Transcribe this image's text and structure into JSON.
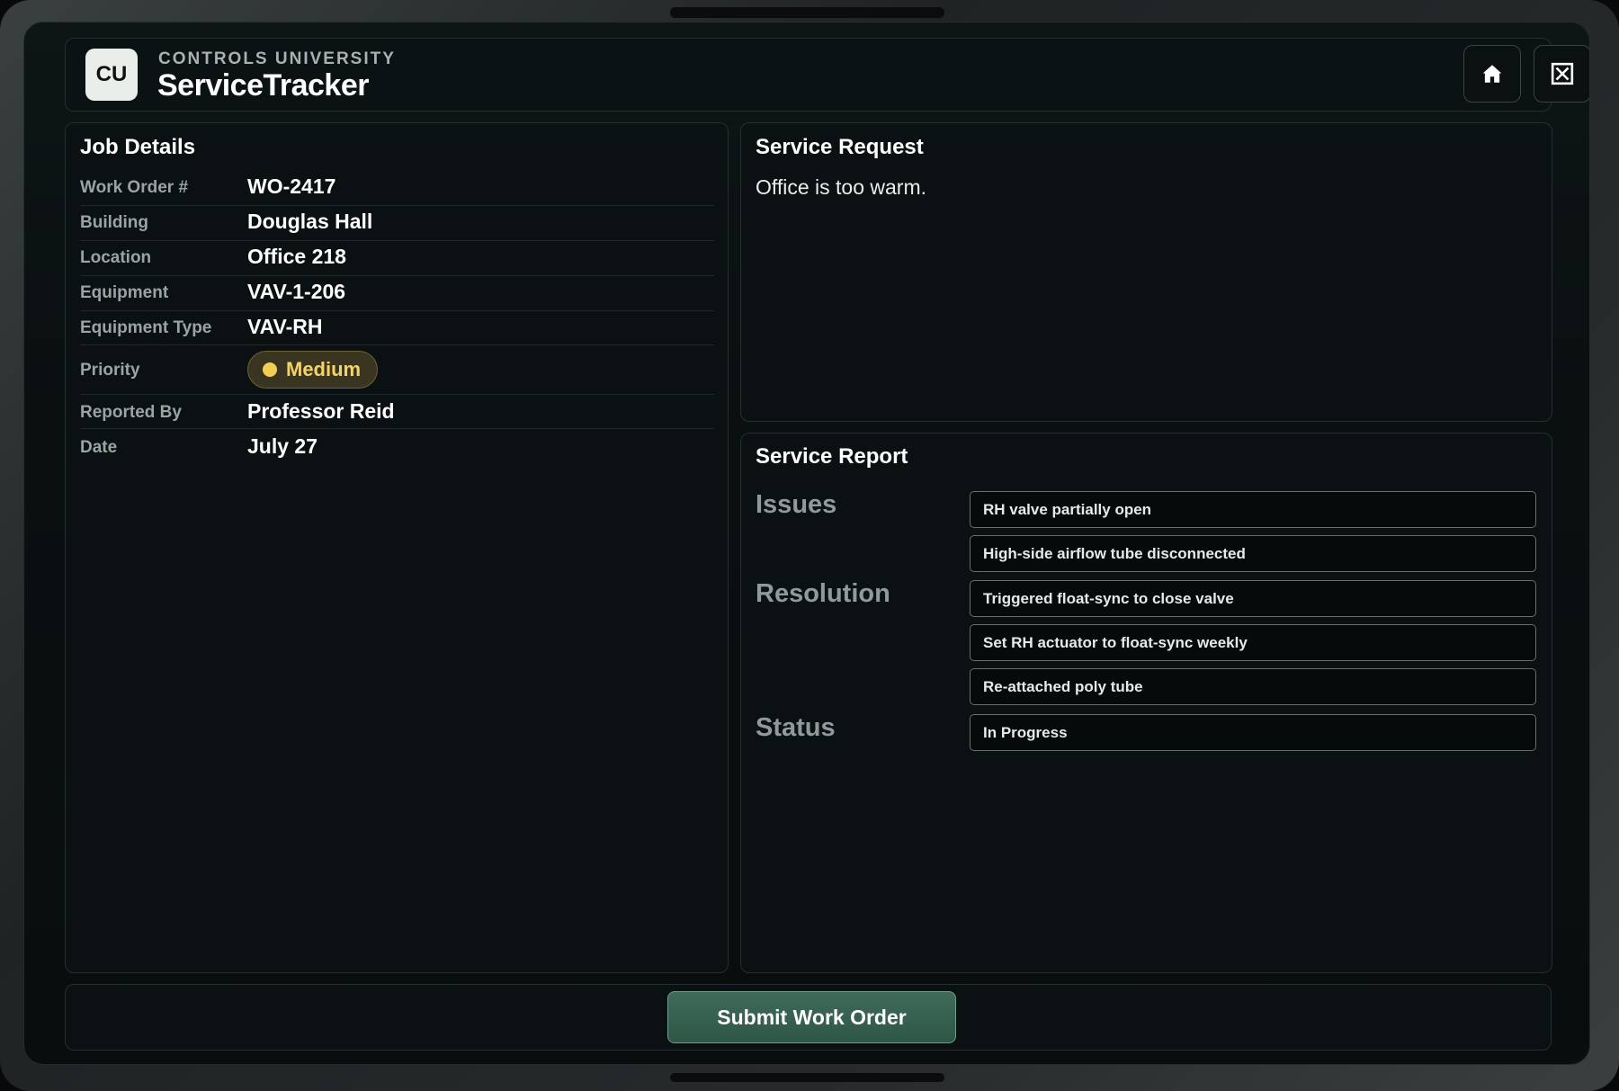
{
  "header": {
    "logo_text": "CU",
    "org_name": "CONTROLS UNIVERSITY",
    "app_title": "ServiceTracker",
    "home_icon": "home-icon",
    "close_icon": "close-box-icon"
  },
  "job_details": {
    "title": "Job Details",
    "rows": [
      {
        "label": "Work Order #",
        "value": "WO-2417"
      },
      {
        "label": "Building",
        "value": "Douglas Hall"
      },
      {
        "label": "Location",
        "value": "Office 218"
      },
      {
        "label": "Equipment",
        "value": "VAV-1-206"
      },
      {
        "label": "Equipment Type",
        "value": "VAV-RH"
      },
      {
        "label": "Priority",
        "value": "Medium"
      },
      {
        "label": "Reported By",
        "value": "Professor Reid"
      },
      {
        "label": "Date",
        "value": "July 27"
      }
    ]
  },
  "service_request": {
    "title": "Service Request",
    "text": "Office is too warm."
  },
  "service_report": {
    "title": "Service Report",
    "issues_label": "Issues",
    "issues": [
      "RH valve partially open",
      "High-side airflow tube disconnected"
    ],
    "resolution_label": "Resolution",
    "resolution": [
      "Triggered float-sync to close valve",
      "Set RH actuator to float-sync weekly",
      "Re-attached poly tube"
    ],
    "status_label": "Status",
    "status": "In Progress"
  },
  "footer": {
    "submit_label": "Submit Work Order"
  },
  "colors": {
    "priority_medium": "#f0cf57",
    "submit_button": "#3f6b5b",
    "background": "#0a0f10"
  }
}
